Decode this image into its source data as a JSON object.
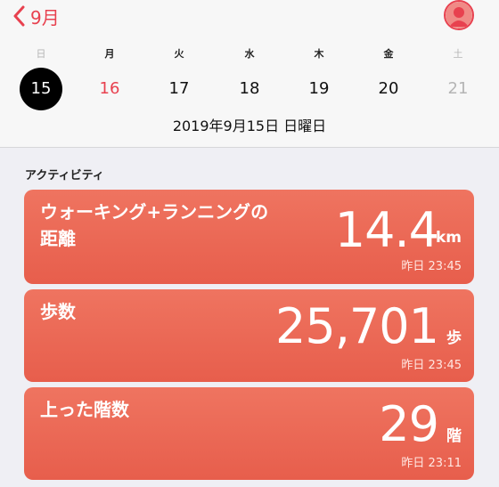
{
  "header": {
    "back_label": "9月"
  },
  "week": {
    "weekdays": [
      "日",
      "月",
      "火",
      "水",
      "木",
      "金",
      "土"
    ],
    "days": [
      "15",
      "16",
      "17",
      "18",
      "19",
      "20",
      "21"
    ],
    "selected_date": "2019年9月15日 日曜日"
  },
  "activity": {
    "section_title": "アクティビティ",
    "cards": [
      {
        "title_line1": "ウォーキング+ランニングの",
        "title_line2": "距離",
        "value": "14.4",
        "unit": "km",
        "time": "昨日 23:45"
      },
      {
        "title_line1": "歩数",
        "title_line2": "",
        "value": "25,701",
        "unit": "歩",
        "time": "昨日 23:45"
      },
      {
        "title_line1": "上った階数",
        "title_line2": "",
        "value": "29",
        "unit": "階",
        "time": "昨日 23:11"
      }
    ]
  },
  "colors": {
    "accent": "#e8414f",
    "card": "#ec6a57",
    "background": "#efeff4"
  },
  "icons": {
    "back": "chevron-left-icon",
    "profile": "person-icon"
  }
}
